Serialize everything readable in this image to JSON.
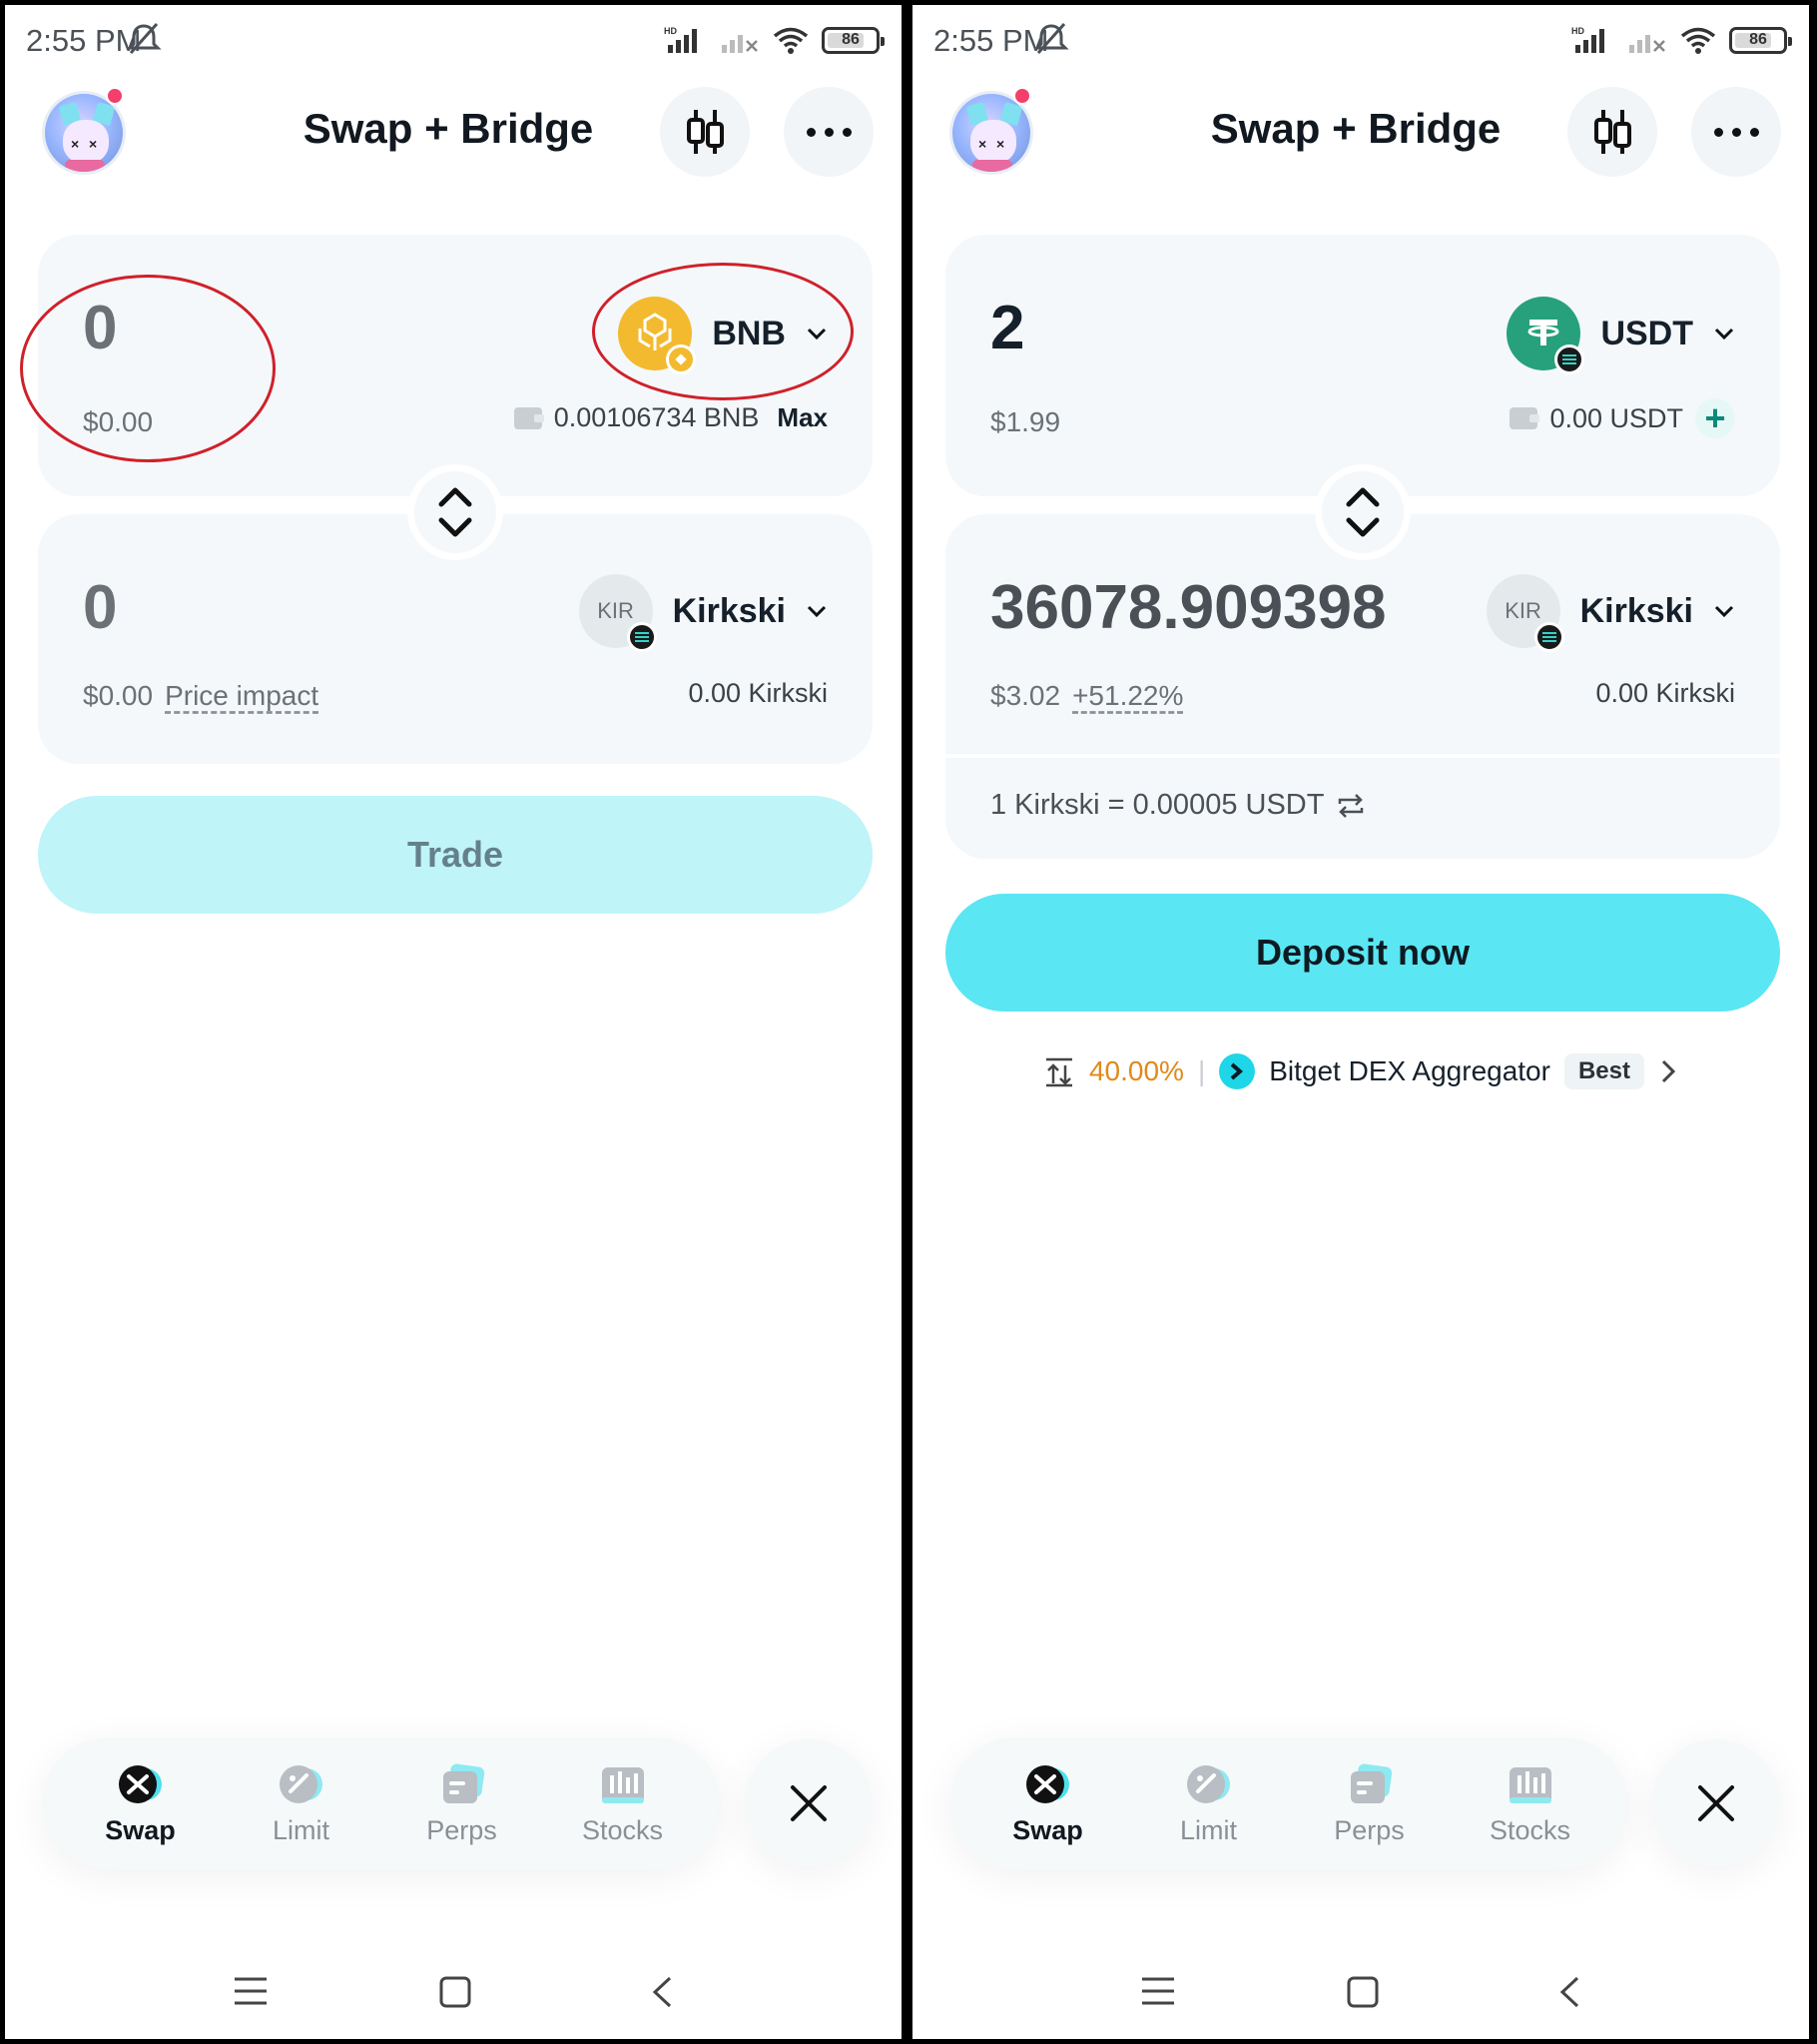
{
  "status_bar": {
    "time": "2:55 PM",
    "battery": "86"
  },
  "header": {
    "title": "Swap + Bridge"
  },
  "left": {
    "from": {
      "amount": "0",
      "usd": "$0.00",
      "token": "BNB",
      "balance": "0.00106734 BNB",
      "max_label": "Max"
    },
    "to": {
      "amount": "0",
      "usd": "$0.00",
      "price_impact_label": "Price impact",
      "token_icon_text": "KIR",
      "token": "Kirkski",
      "balance": "0.00 Kirkski"
    },
    "action_button": "Trade"
  },
  "right": {
    "from": {
      "amount": "2",
      "usd": "$1.99",
      "token": "USDT",
      "balance": "0.00 USDT",
      "plus": "+"
    },
    "to": {
      "amount": "36078.909398",
      "usd": "$3.02",
      "price_impact": "+51.22%",
      "token_icon_text": "KIR",
      "token": "Kirkski",
      "balance": "0.00 Kirkski"
    },
    "rate": "1 Kirkski = 0.00005 USDT",
    "action_button": "Deposit now",
    "route": {
      "slippage": "40.00%",
      "provider": "Bitget DEX Aggregator",
      "badge": "Best"
    }
  },
  "bottom_nav": {
    "items": [
      "Swap",
      "Limit",
      "Perps",
      "Stocks"
    ],
    "active": "Swap"
  },
  "colors": {
    "accent": "#5ae6f2",
    "accent_disabled": "#bff4f8",
    "annotation": "#d0202a",
    "warning": "#e08a1a"
  }
}
